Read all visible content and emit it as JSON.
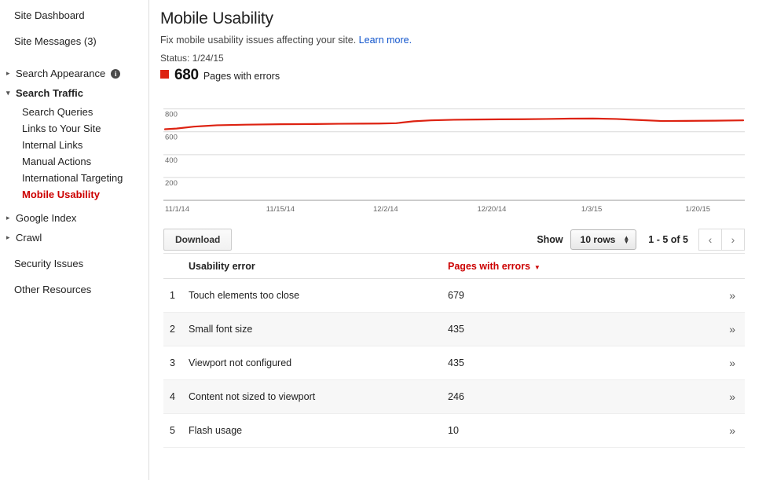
{
  "sidebar": {
    "top_items": [
      {
        "label": "Site Dashboard",
        "name": "site-dashboard"
      },
      {
        "label": "Site Messages (3)",
        "name": "site-messages"
      }
    ],
    "groups": [
      {
        "label": "Search Appearance",
        "state": "collapsed",
        "has_info_icon": true,
        "info_glyph": "i"
      },
      {
        "label": "Search Traffic",
        "state": "expanded",
        "has_info_icon": false
      }
    ],
    "search_traffic_children": [
      {
        "label": "Search Queries",
        "active": false
      },
      {
        "label": "Links to Your Site",
        "active": false
      },
      {
        "label": "Internal Links",
        "active": false
      },
      {
        "label": "Manual Actions",
        "active": false
      },
      {
        "label": "International Targeting",
        "active": false
      },
      {
        "label": "Mobile Usability",
        "active": true
      }
    ],
    "lower_groups": [
      {
        "label": "Google Index",
        "state": "collapsed"
      },
      {
        "label": "Crawl",
        "state": "collapsed"
      }
    ],
    "bottom_items": [
      {
        "label": "Security Issues",
        "name": "security-issues"
      },
      {
        "label": "Other Resources",
        "name": "other-resources"
      }
    ],
    "active_color": "#cc0000"
  },
  "header": {
    "title": "Mobile Usability",
    "subtitle_text": "Fix mobile usability issues affecting your site.",
    "learn_more": "Learn more.",
    "status": "Status: 1/24/15",
    "legend_count": "680",
    "legend_label": "Pages with errors",
    "legend_color": "#dd2211",
    "link_color": "#1155cc"
  },
  "chart_data": {
    "type": "line",
    "title": "",
    "xlabel": "",
    "ylabel": "",
    "ylim": [
      0,
      880
    ],
    "yticks": [
      200,
      400,
      600,
      800
    ],
    "grid": true,
    "legend": "Pages with errors",
    "line_color": "#dd2211",
    "xtick_labels": [
      "11/1/14",
      "11/15/14",
      "12/2/14",
      "12/20/14",
      "1/3/15",
      "1/20/15"
    ],
    "xtick_positions": [
      0,
      0.175,
      0.36,
      0.54,
      0.72,
      0.9
    ],
    "x": [
      0.0,
      0.02,
      0.05,
      0.09,
      0.14,
      0.2,
      0.26,
      0.3,
      0.34,
      0.37,
      0.4,
      0.43,
      0.46,
      0.5,
      0.54,
      0.58,
      0.62,
      0.66,
      0.7,
      0.74,
      0.78,
      0.82,
      0.86,
      0.9,
      0.95,
      1.0
    ],
    "values": [
      622,
      628,
      645,
      657,
      662,
      666,
      668,
      670,
      671,
      672,
      675,
      692,
      700,
      705,
      707,
      709,
      710,
      712,
      715,
      716,
      712,
      703,
      694,
      695,
      697,
      700
    ]
  },
  "toolbar": {
    "download_label": "Download",
    "show_label": "Show",
    "rows_value": "10 rows",
    "range_label": "1 - 5 of 5",
    "prev_glyph": "‹",
    "next_glyph": "›"
  },
  "table": {
    "columns": [
      "",
      "Usability error",
      "Pages with errors",
      ""
    ],
    "sorted_column": "Pages with errors",
    "sort_caret": "▼",
    "row_chevron": "»",
    "rows": [
      {
        "index": "1",
        "error": "Touch elements too close",
        "count": "679"
      },
      {
        "index": "2",
        "error": "Small font size",
        "count": "435"
      },
      {
        "index": "3",
        "error": "Viewport not configured",
        "count": "435"
      },
      {
        "index": "4",
        "error": "Content not sized to viewport",
        "count": "246"
      },
      {
        "index": "5",
        "error": "Flash usage",
        "count": "10"
      }
    ]
  }
}
